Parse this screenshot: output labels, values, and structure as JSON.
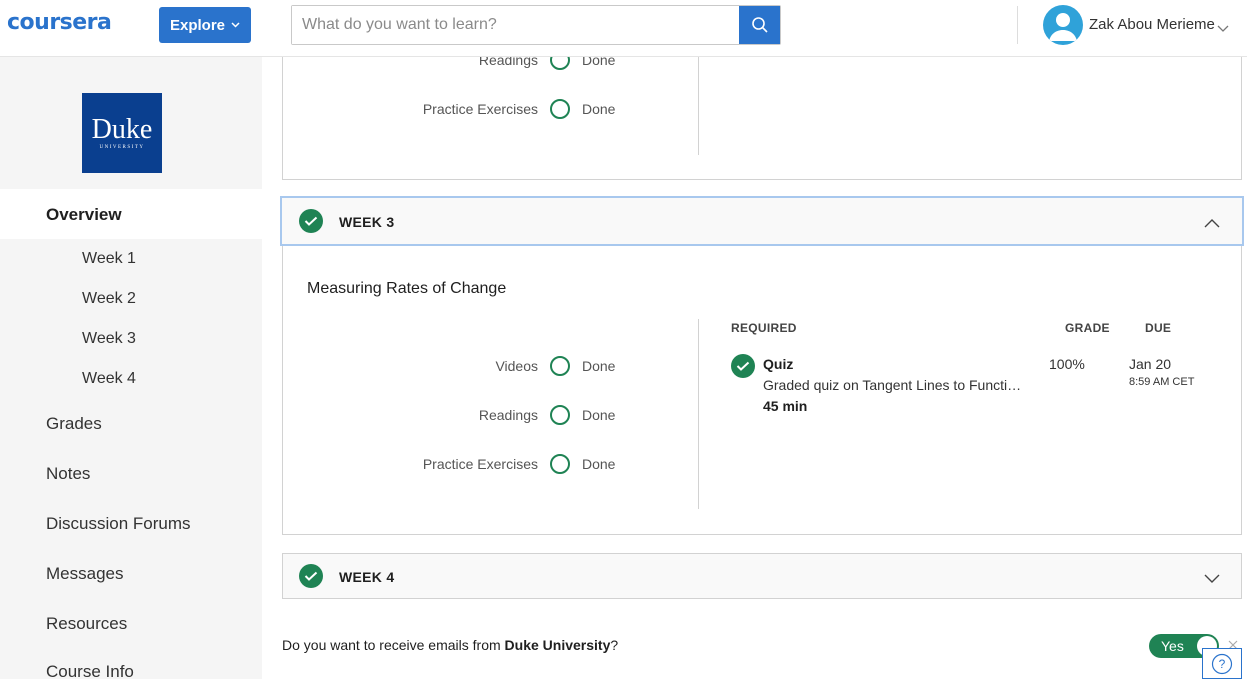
{
  "header": {
    "logo": "coursera",
    "explore_label": "Explore",
    "search_placeholder": "What do you want to learn?",
    "user_name": "Zak Abou Merieme"
  },
  "sidebar": {
    "logo_main": "Duke",
    "logo_sub": "UNIVERSITY",
    "overview": "Overview",
    "weeks": [
      "Week 1",
      "Week 2",
      "Week 3",
      "Week 4"
    ],
    "items": [
      "Grades",
      "Notes",
      "Discussion Forums",
      "Messages",
      "Resources",
      "Course Info"
    ]
  },
  "week2_partial": {
    "rows": [
      {
        "label": "Readings",
        "status": "Done"
      },
      {
        "label": "Practice Exercises",
        "status": "Done"
      }
    ]
  },
  "week3": {
    "title": "WEEK 3",
    "section_title": "Measuring Rates of Change",
    "rows": [
      {
        "label": "Videos",
        "status": "Done"
      },
      {
        "label": "Readings",
        "status": "Done"
      },
      {
        "label": "Practice Exercises",
        "status": "Done"
      }
    ],
    "columns": {
      "required": "REQUIRED",
      "grade": "GRADE",
      "due": "DUE"
    },
    "item": {
      "title": "Quiz",
      "description": "Graded quiz on Tangent Lines to Functions",
      "duration": "45 min",
      "grade": "100%",
      "due_date": "Jan 20",
      "due_time": "8:59 AM CET"
    }
  },
  "week4": {
    "title": "WEEK 4"
  },
  "email": {
    "question_prefix": "Do you want to receive emails from ",
    "org": "Duke University",
    "question_suffix": "?",
    "toggle_label": "Yes"
  },
  "colors": {
    "brand": "#2a73cc",
    "success": "#1f8354"
  }
}
